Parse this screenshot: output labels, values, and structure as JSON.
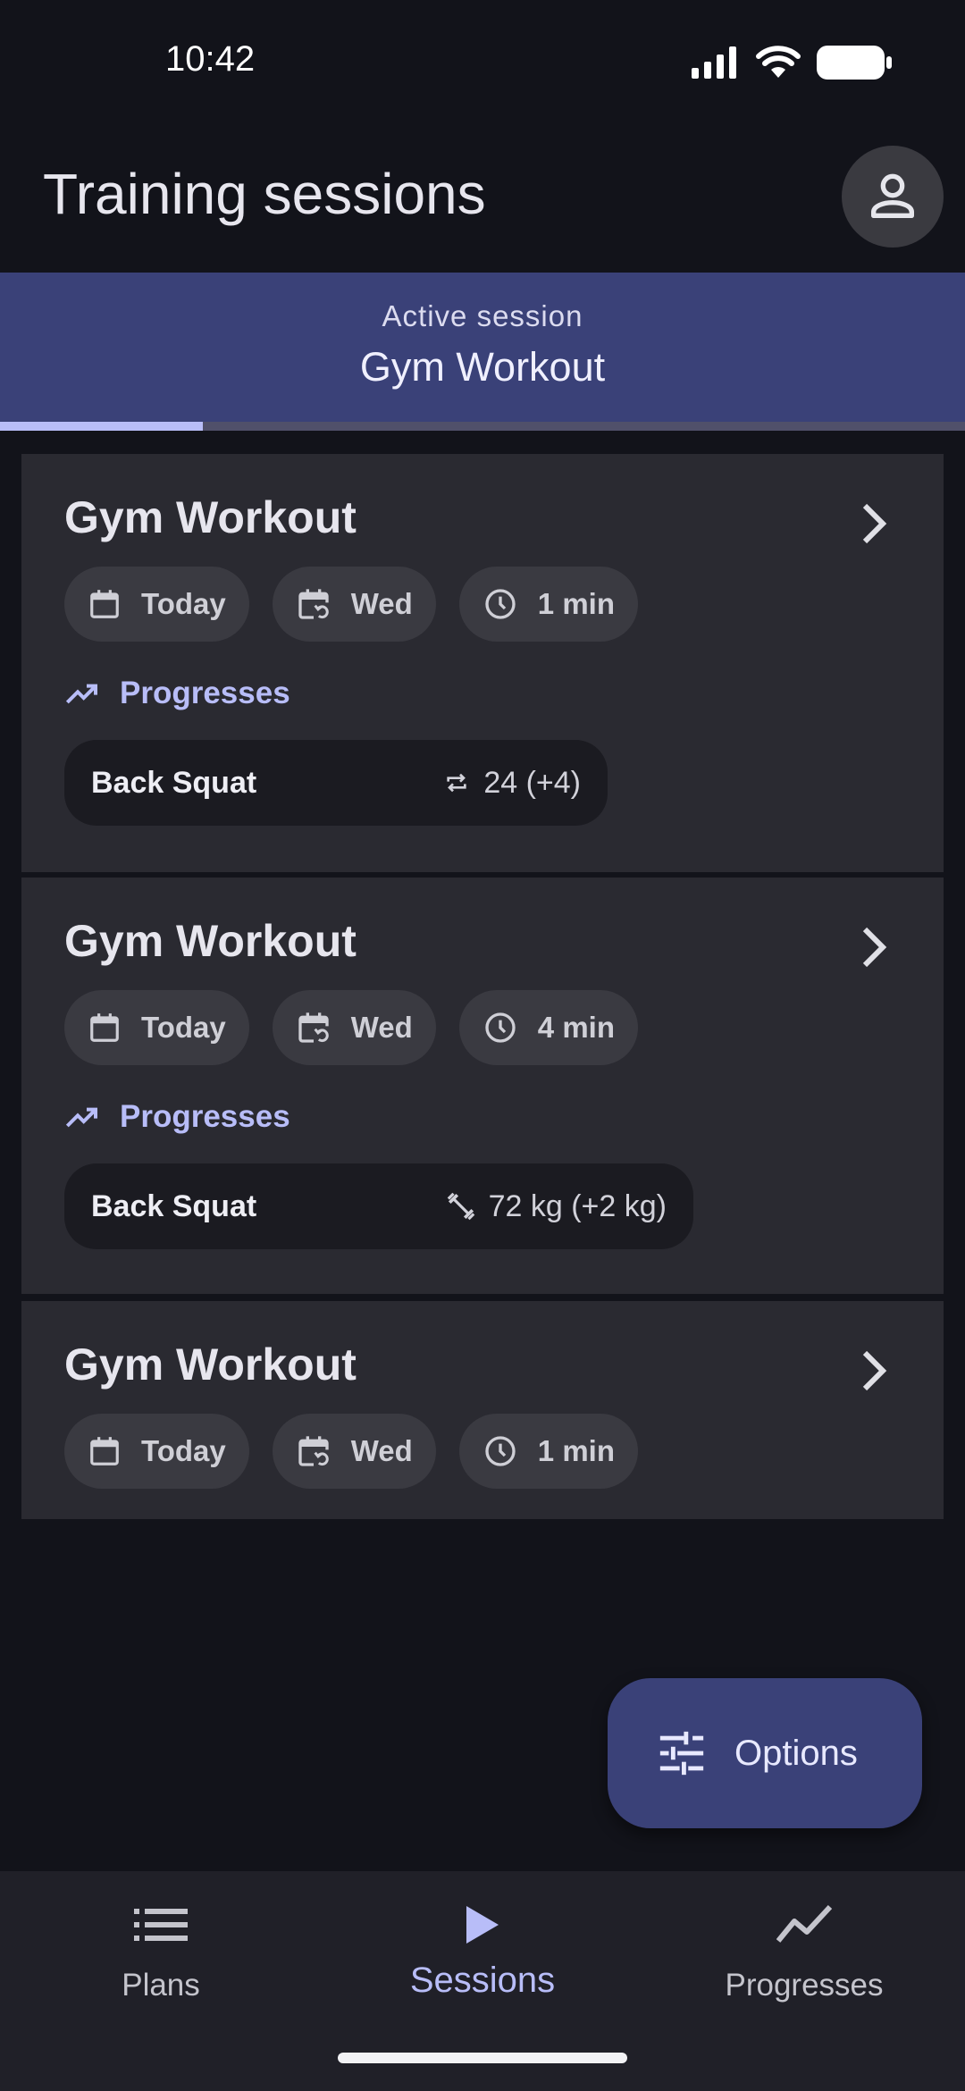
{
  "status_bar": {
    "time": "10:42"
  },
  "header": {
    "title": "Training sessions"
  },
  "active_session": {
    "label": "Active session",
    "name": "Gym Workout",
    "progress": 0.21
  },
  "sessions": [
    {
      "title": "Gym Workout",
      "chips": {
        "date": "Today",
        "day": "Wed",
        "duration": "1 min"
      },
      "progress_heading": "Progresses",
      "progress": {
        "exercise": "Back Squat",
        "value": "24 (+4)",
        "icon": "repeat-icon"
      }
    },
    {
      "title": "Gym Workout",
      "chips": {
        "date": "Today",
        "day": "Wed",
        "duration": "4 min"
      },
      "progress_heading": "Progresses",
      "progress": {
        "exercise": "Back Squat",
        "value": "72 kg (+2 kg)",
        "icon": "weight-icon"
      }
    },
    {
      "title": "Gym Workout",
      "chips": {
        "date": "Today",
        "day": "Wed",
        "duration": "1 min"
      }
    }
  ],
  "fab": {
    "label": "Options"
  },
  "nav": {
    "items": [
      {
        "label": "Plans",
        "icon": "list-icon"
      },
      {
        "label": "Sessions",
        "icon": "play-icon",
        "active": true
      },
      {
        "label": "Progresses",
        "icon": "trend-icon"
      }
    ]
  },
  "colors": {
    "accent": "#b8bdf8",
    "banner": "#3a4178",
    "card": "#2a2a31",
    "background": "#12131a"
  }
}
